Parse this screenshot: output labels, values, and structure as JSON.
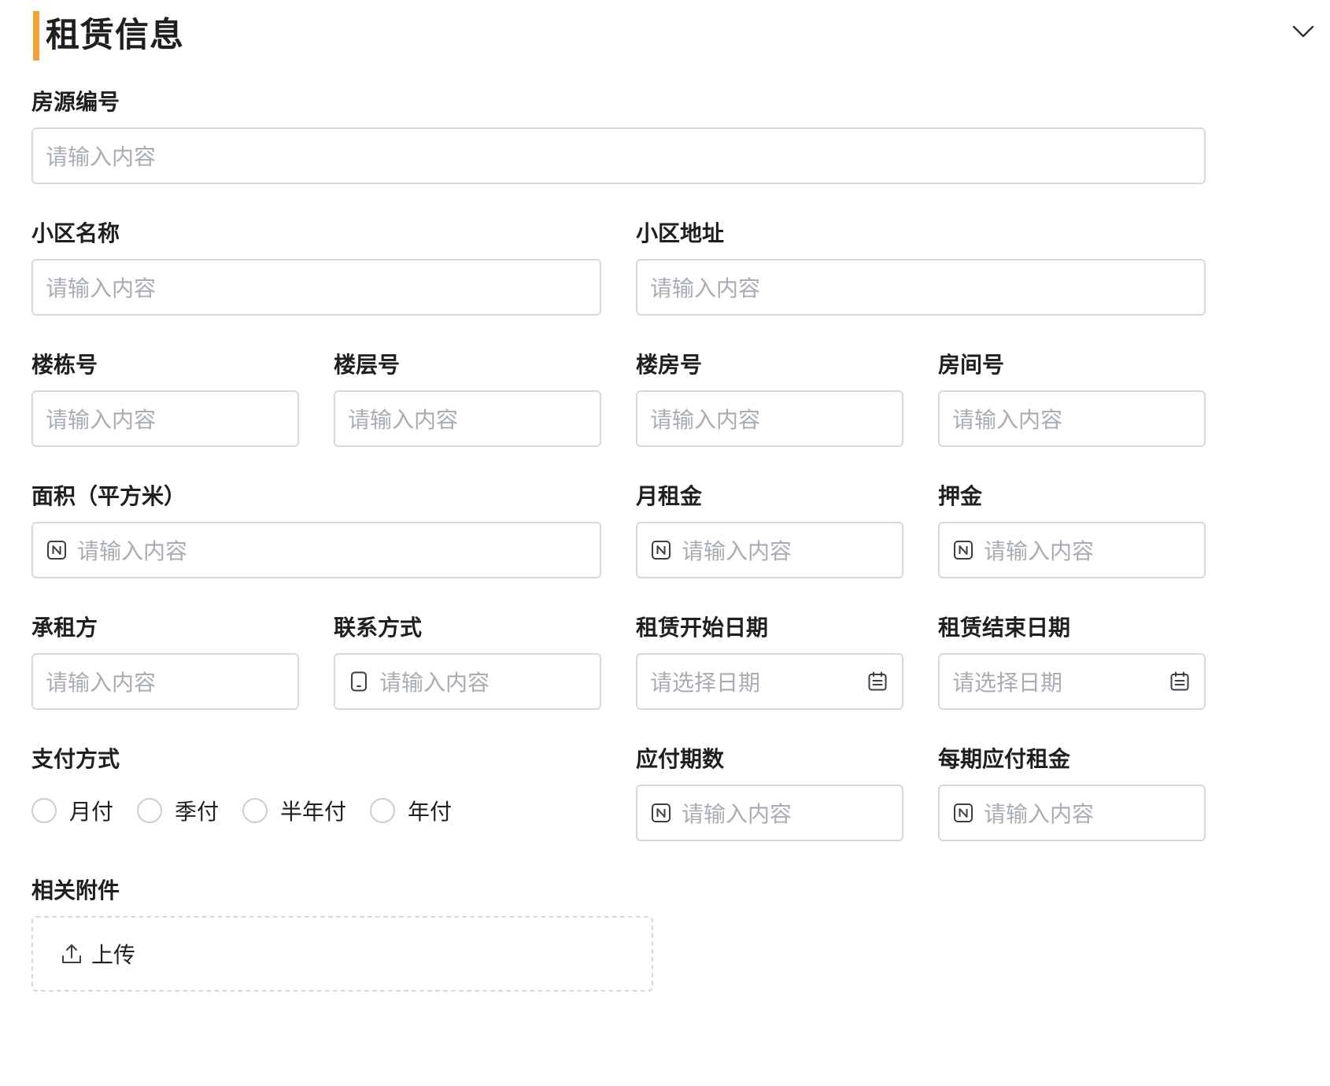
{
  "section": {
    "title": "租赁信息"
  },
  "placeholders": {
    "input": "请输入内容",
    "date": "请选择日期"
  },
  "fields": {
    "house_id": "房源编号",
    "community_name": "小区名称",
    "community_address": "小区地址",
    "building_no": "楼栋号",
    "floor_no": "楼层号",
    "unit_no": "楼房号",
    "room_no": "房间号",
    "area": "面积（平方米）",
    "monthly_rent": "月租金",
    "deposit": "押金",
    "tenant": "承租方",
    "contact": "联系方式",
    "lease_start": "租赁开始日期",
    "lease_end": "租赁结束日期",
    "payment_method": "支付方式",
    "payment_periods": "应付期数",
    "rent_per_period": "每期应付租金",
    "attachments": "相关附件"
  },
  "payment_options": [
    "月付",
    "季付",
    "半年付",
    "年付"
  ],
  "upload": {
    "label": "上传"
  },
  "colors": {
    "accent": "#f0a13a",
    "border": "#d5d9de",
    "placeholder": "#a8adb4",
    "text": "#1f1f1f"
  },
  "icons": {
    "collapse": "chevron-down-icon",
    "number": "number-icon",
    "phone": "phone-icon",
    "calendar": "calendar-icon",
    "upload": "upload-icon"
  }
}
